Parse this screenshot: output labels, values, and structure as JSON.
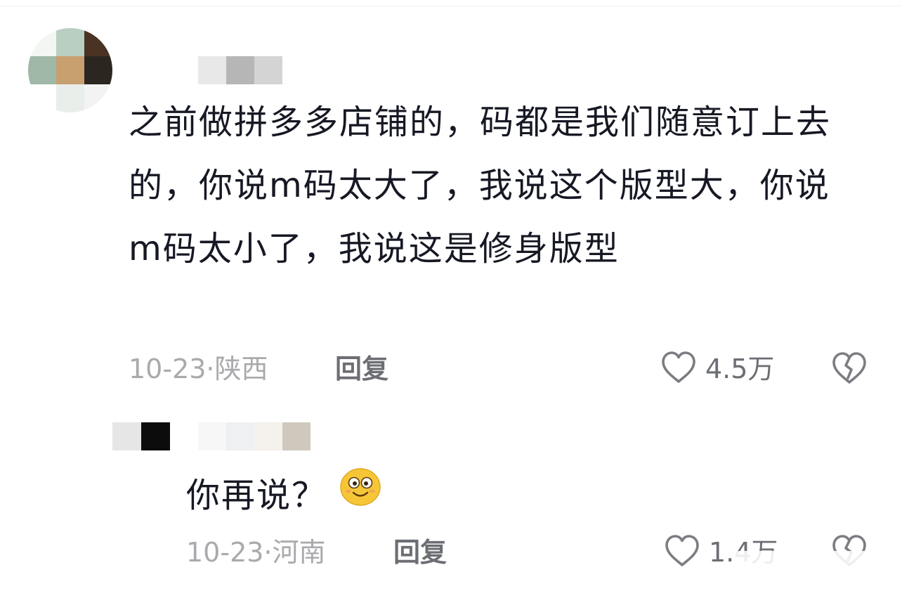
{
  "comments": [
    {
      "text": "之前做拼多多店铺的，码都是我们随意订上去的，你说m码太大了，我说这个版型大，你说m码太小了，我说这是修身版型",
      "date": "10-23",
      "location": "陕西",
      "reply_label": "回复",
      "likes": "4.5万",
      "avatar_colors": [
        "#f4f6f4",
        "#b8cfc1",
        "#4a3323",
        "#9fb8a7",
        "#c8a06f",
        "#2c2620",
        "#ffffff",
        "#e9eeea",
        "#f3f3f3"
      ],
      "username_colors": [
        "#e8e8e8",
        "#b6b6b6",
        "#d4d4d4"
      ]
    },
    {
      "text": "你再说？",
      "emoji": "smile-emoji",
      "date": "10-23",
      "location": "河南",
      "reply_label": "回复",
      "likes": "1.4万",
      "avatar_colors": [
        "#e6e6e6",
        "#0c0c0c"
      ],
      "username_colors": [
        "#f7f7f7",
        "#eef0f2",
        "#f5f2ee",
        "#cfc8bd"
      ]
    }
  ],
  "colors": {
    "text_primary": "#161823",
    "text_secondary": "#a9aaad",
    "action_text": "#6c6e74",
    "icon_stroke": "#7b7d82",
    "emoji_face": "#f6c637"
  },
  "icons": [
    "heart-icon",
    "dislike-broken-heart-icon",
    "smile-emoji"
  ]
}
